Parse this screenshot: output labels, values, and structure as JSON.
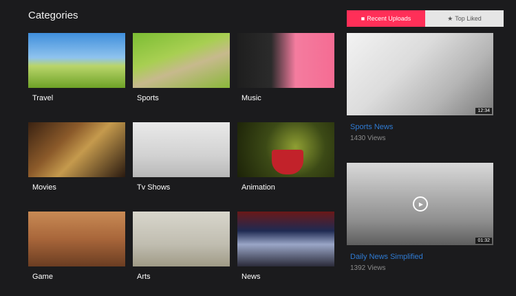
{
  "categories": {
    "title": "Categories",
    "items": [
      {
        "label": "Travel"
      },
      {
        "label": "Sports"
      },
      {
        "label": "Music"
      },
      {
        "label": "Movies"
      },
      {
        "label": "Tv Shows"
      },
      {
        "label": "Animation"
      },
      {
        "label": "Game"
      },
      {
        "label": "Arts"
      },
      {
        "label": "News"
      }
    ]
  },
  "tabs": {
    "recent_label": "Recent Uploads",
    "top_label": "Top Liked",
    "recent_icon": "video-camera-icon",
    "top_icon": "star-icon"
  },
  "videos": [
    {
      "title": "Sports News",
      "views": "1430 Views",
      "duration": "12:34"
    },
    {
      "title": "Daily News Simplified",
      "views": "1392 Views",
      "duration": "01:32"
    }
  ],
  "colors": {
    "accent": "#ff2f58",
    "link": "#2f7bd3",
    "background": "#1b1b1d"
  }
}
